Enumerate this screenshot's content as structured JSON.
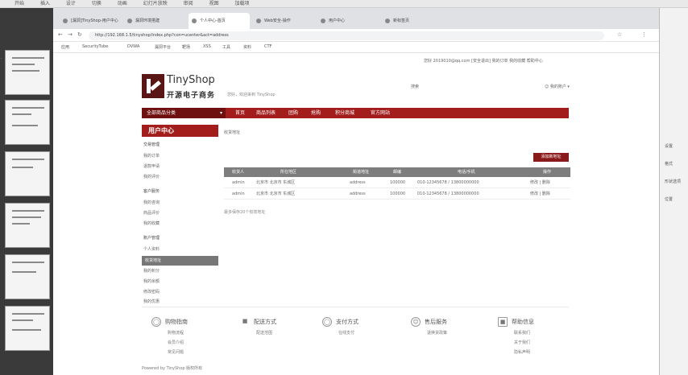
{
  "app": {
    "menu": [
      "开始",
      "插入",
      "设计",
      "切换",
      "动画",
      "幻灯片放映",
      "审阅",
      "视图",
      "加载项"
    ]
  },
  "right_pane": {
    "items": [
      "设置",
      "格式",
      "形状选项",
      "位置"
    ]
  },
  "browser": {
    "tabs": [
      {
        "label": "[漏洞]TinyShop-用户中心"
      },
      {
        "label": "漏洞环境搭建"
      },
      {
        "label": "个人中心-首页"
      },
      {
        "label": "Web安全-操作"
      },
      {
        "label": "用户中心"
      },
      {
        "label": "新标签页"
      }
    ],
    "url": "http://192.168.1.5/tinyshop/index.php?con=ucenter&act=address",
    "bookmarks": [
      "应用",
      "SecurityTube",
      "DVWA",
      "漏洞平台",
      "靶场",
      "XSS",
      "工具",
      "资料",
      "CTF"
    ]
  },
  "page": {
    "top_info": "您好 2019010@qq.com [安全退出] 我的订单 我的收藏 帮助中心",
    "logo_en": "TinyShop",
    "logo_cn": "开源电子商务",
    "welcome": "您好，欢迎来到 TinyShop",
    "search_label": "搜索",
    "my_account": "我的账户",
    "nav": {
      "category": "全部商品分类",
      "items": [
        "首页",
        "商品列表",
        "团购",
        "抢购",
        "积分商城",
        "官方网站"
      ]
    },
    "sidebar": {
      "title": "用户中心",
      "items": [
        "交易管理",
        "我的订单",
        "退款申请",
        "我的评价",
        "客户服务",
        "我的咨询",
        "商品评价",
        "我的收藏",
        "账户管理",
        "个人资料",
        "收货地址",
        "我的积分",
        "我的余额",
        "修改密码",
        "我的优惠"
      ],
      "active": "收货地址"
    },
    "breadcrumb": "收货地址",
    "add_button": "添加新地址",
    "table": {
      "headers": [
        "收货人",
        "所在地区",
        "街道地址",
        "邮编",
        "电话/手机",
        "操作"
      ],
      "rows": [
        [
          "admin",
          "北京市 北京市 东城区",
          "address",
          "100000",
          "010-12345678 / 13800000000",
          "修改 | 删除"
        ],
        [
          "admin",
          "北京市 北京市 东城区",
          "address",
          "100000",
          "010-12345678 / 13800000000",
          "修改 | 删除"
        ]
      ]
    },
    "table_note": "最多保存20个有效地址",
    "footer": {
      "columns": [
        {
          "icon": "cart-icon",
          "title": "购物指南",
          "links": [
            "购物流程",
            "会员介绍",
            "常见问题"
          ]
        },
        {
          "icon": "truck-icon",
          "title": "配送方式",
          "links": [
            "配送范围"
          ]
        },
        {
          "icon": "payment-icon",
          "title": "支付方式",
          "links": [
            "在线支付"
          ]
        },
        {
          "icon": "service-icon",
          "title": "售后服务",
          "links": [
            "退换货政策"
          ]
        },
        {
          "icon": "help-icon",
          "title": "帮助信息",
          "links": [
            "联系我们",
            "关于我们",
            "隐私声明"
          ]
        }
      ],
      "copyright": "Powered by TinyShop 版权所有"
    }
  }
}
